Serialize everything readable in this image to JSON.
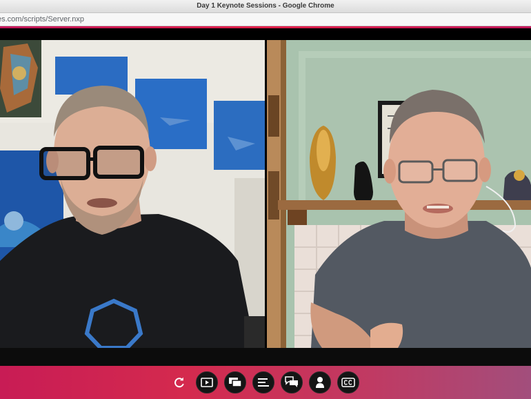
{
  "window": {
    "title": "Day 1 Keynote Sessions - Google Chrome"
  },
  "address_bar": {
    "url": "es.com/scripts/Server.nxp"
  },
  "colors": {
    "accent": "#d42a4e",
    "control_bar_start": "#c81c55",
    "control_bar_end": "#a24e7c",
    "button_bg": "#151515"
  },
  "controls": [
    {
      "name": "refresh",
      "icon": "refresh-icon"
    },
    {
      "name": "video",
      "icon": "play-screen-icon"
    },
    {
      "name": "screens",
      "icon": "screen-share-icon"
    },
    {
      "name": "agenda",
      "icon": "list-icon"
    },
    {
      "name": "chat",
      "icon": "chat-icon"
    },
    {
      "name": "participant",
      "icon": "person-icon"
    },
    {
      "name": "captions",
      "icon": "cc-icon"
    }
  ]
}
